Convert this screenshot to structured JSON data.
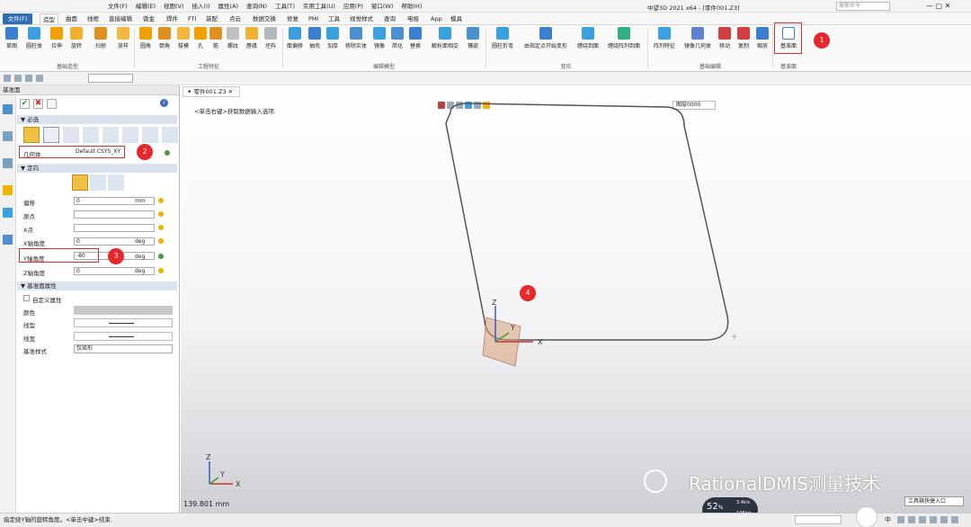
{
  "window": {
    "title": "中望3D 2021 x64 - [零件001.Z3]",
    "menu": [
      "文件(F)",
      "编辑(E)",
      "视图(V)",
      "插入(I)",
      "属性(A)",
      "查询(N)",
      "工具(T)",
      "实用工具(U)",
      "应用(P)",
      "窗口(W)",
      "帮助(H)"
    ],
    "search_placeholder": "搜索命令"
  },
  "ribbon_tabs": [
    "文件(F)",
    "造型",
    "曲面",
    "线框",
    "直接编辑",
    "钣金",
    "焊件",
    "FTI",
    "装配",
    "点云",
    "数据交换",
    "修复",
    "PMI",
    "工具",
    "视觉样式",
    "查询",
    "电极",
    "App",
    "模具"
  ],
  "ribbon_active_tab": "造型",
  "ribbon": {
    "groups": [
      {
        "label": "基础造型",
        "items": [
          "草图",
          "圆柱体",
          "拉伸",
          "旋转",
          "扫掠",
          "放样"
        ]
      },
      {
        "label": "工程特征",
        "items": [
          "圆角",
          "倒角",
          "拔模",
          "孔",
          "筋",
          "螺纹",
          "唇缘",
          "坯料"
        ]
      },
      {
        "label": "编辑模型",
        "items": [
          "面偏移",
          "抽壳",
          "加厚",
          "移除实体",
          "镜像",
          "简化",
          "替换",
          "解析面相交",
          "镶嵌"
        ]
      },
      {
        "label": "变形",
        "items": [
          "圆柱折弯",
          "由指定点开始变形",
          "缠绕到面",
          "缠绕阵列到面"
        ]
      },
      {
        "label": "基础编辑",
        "items": [
          "阵列特征",
          "镜像几何体",
          "移动",
          "复制",
          "缩放"
        ]
      },
      {
        "label": "基准面",
        "items": [
          "基准面"
        ]
      }
    ]
  },
  "panel": {
    "title": "基准面",
    "sections": {
      "required": "必选",
      "orientation": "定向",
      "properties": "基准面属性"
    },
    "geometry_label": "几何体",
    "geometry_value": "Default CSYS_XY",
    "fields": [
      {
        "label": "偏移",
        "value": "0",
        "unit": "mm"
      },
      {
        "label": "原点",
        "value": "",
        "unit": ""
      },
      {
        "label": "X点",
        "value": "",
        "unit": ""
      },
      {
        "label": "X轴角度",
        "value": "0",
        "unit": "deg"
      },
      {
        "label": "Y轴角度",
        "value": "-80",
        "unit": "deg"
      },
      {
        "label": "Z轴角度",
        "value": "0",
        "unit": "deg"
      }
    ],
    "properties": {
      "custom_label": "自定义属性",
      "color_label": "颜色",
      "linetype_label": "线型",
      "linewidth_label": "线宽",
      "style_label": "基准样式",
      "style_value": "仅矩形"
    }
  },
  "viewport": {
    "doc_tab": "零件001.Z3",
    "hint": "<单击右键>获取数据输入选项.",
    "view_box": "图层0000",
    "scale_text": "139.801 mm",
    "axis_labels": [
      "X",
      "Y",
      "Z"
    ]
  },
  "callouts": [
    "1",
    "2",
    "3",
    "4"
  ],
  "status": {
    "text": "指定绕Y轴的旋转角度。<单击中键>结束.",
    "perf_value": "52",
    "perf_unit": "%",
    "net_up": "3.4k/s",
    "net_down": "106k/s",
    "tool_entry": "工具箱快捷入口",
    "ime": "中"
  },
  "watermark": "RationalDMIS测量技术"
}
